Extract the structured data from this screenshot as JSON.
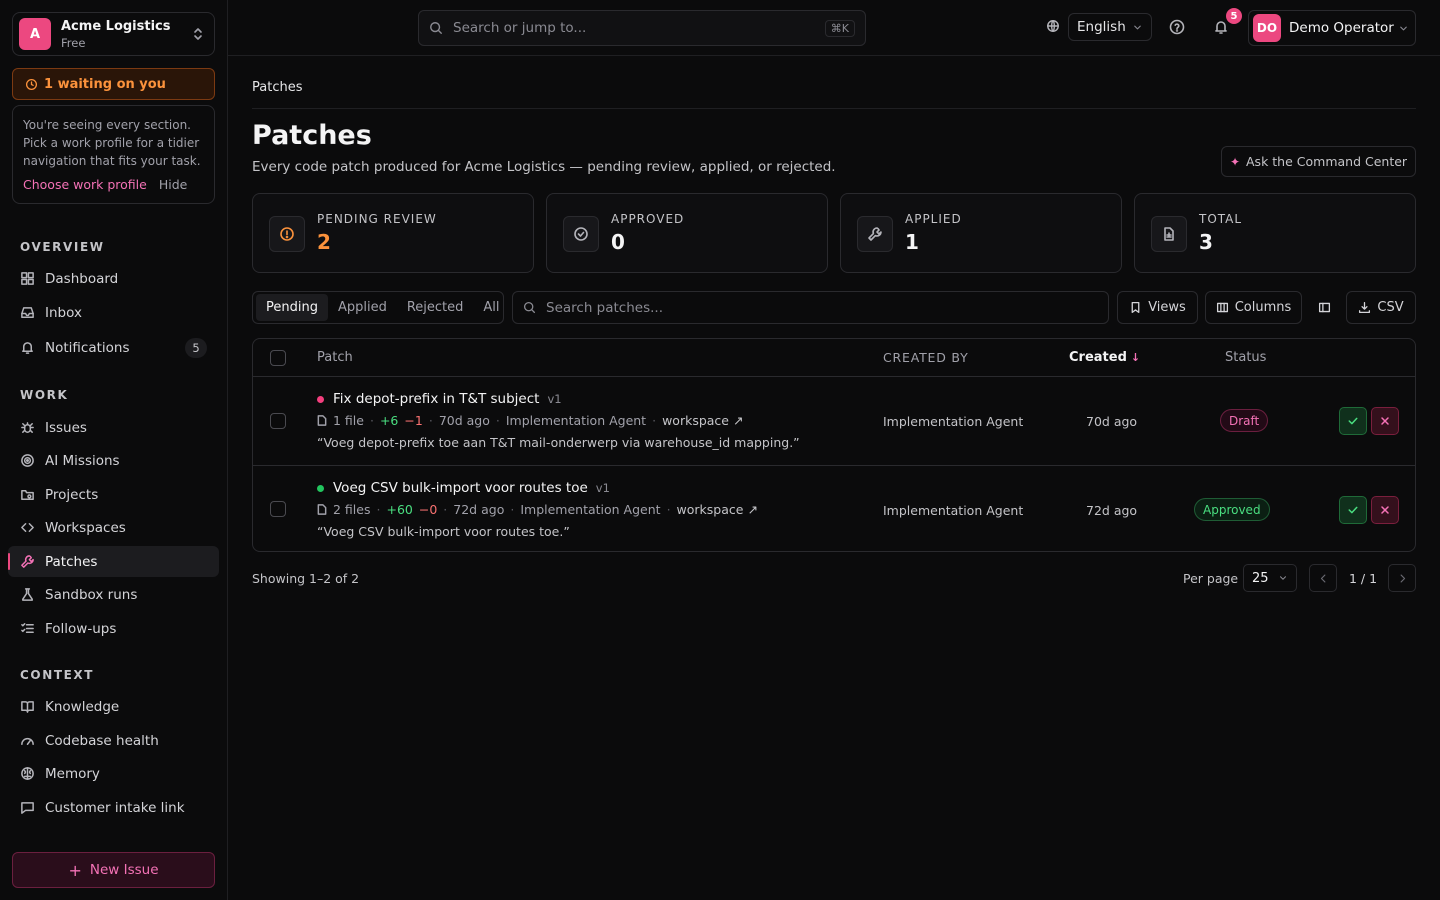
{
  "org": {
    "initial": "A",
    "name": "Acme Logistics",
    "plan": "Free"
  },
  "waiting": {
    "label": "1 waiting on you"
  },
  "profile_hint": {
    "text": "You're seeing every section. Pick a work profile for a tidier navigation that fits your task.",
    "choose_label": "Choose work profile",
    "hide_label": "Hide"
  },
  "sidebar": {
    "overview_label": "OVERVIEW",
    "work_label": "WORK",
    "context_label": "CONTEXT",
    "overview": [
      {
        "label": "Dashboard",
        "icon": "grid-icon"
      },
      {
        "label": "Inbox",
        "icon": "inbox-icon"
      },
      {
        "label": "Notifications",
        "icon": "bell-icon",
        "count": "5"
      }
    ],
    "work": [
      {
        "label": "Issues",
        "icon": "bug-icon"
      },
      {
        "label": "AI Missions",
        "icon": "target-icon"
      },
      {
        "label": "Projects",
        "icon": "folder-icon"
      },
      {
        "label": "Workspaces",
        "icon": "code-icon"
      },
      {
        "label": "Patches",
        "icon": "wrench-icon",
        "active": true
      },
      {
        "label": "Sandbox runs",
        "icon": "flask-icon"
      },
      {
        "label": "Follow-ups",
        "icon": "list-check-icon"
      }
    ],
    "context": [
      {
        "label": "Knowledge",
        "icon": "book-icon"
      },
      {
        "label": "Codebase health",
        "icon": "gauge-icon"
      },
      {
        "label": "Memory",
        "icon": "brain-icon"
      },
      {
        "label": "Customer intake link",
        "icon": "message-icon"
      }
    ],
    "new_issue_label": "New Issue",
    "accent": "#ec4880"
  },
  "topbar": {
    "search_placeholder": "Search or jump to...",
    "search_shortcut": "⌘K",
    "language": "English",
    "notif_count": "5",
    "user_initials": "DO",
    "user_name": "Demo Operator"
  },
  "page": {
    "breadcrumb": "Patches",
    "title": "Patches",
    "subtitle": "Every code patch produced for Acme Logistics — pending review, applied, or rejected.",
    "ask_label": "Ask the Command Center"
  },
  "stats": [
    {
      "label": "PENDING REVIEW",
      "value": "2",
      "icon": "alert-circle-icon"
    },
    {
      "label": "APPROVED",
      "value": "0",
      "icon": "check-circle-icon"
    },
    {
      "label": "APPLIED",
      "value": "1",
      "icon": "wrench-icon"
    },
    {
      "label": "TOTAL",
      "value": "3",
      "icon": "file-icon"
    }
  ],
  "filters": {
    "tabs": [
      "Pending",
      "Applied",
      "Rejected",
      "All"
    ],
    "active_tab": "Pending",
    "search_placeholder": "Search patches...",
    "views_label": "Views",
    "columns_label": "Columns",
    "csv_label": "CSV"
  },
  "table": {
    "headers": {
      "patch": "Patch",
      "created_by": "CREATED BY",
      "created": "Created",
      "status": "Status"
    },
    "rows": [
      {
        "title": "Fix depot-prefix in T&T subject",
        "version": "v1",
        "dot_color": "#f43f7e",
        "files": "1 file",
        "added": "+6",
        "removed": "−1",
        "age": "70d ago",
        "agent": "Implementation Agent",
        "workspace": "workspace",
        "quote": "“Voeg depot-prefix toe aan T&T mail-onderwerp via warehouse_id mapping.”",
        "created_by": "Implementation Agent",
        "created": "70d ago",
        "status": "Draft"
      },
      {
        "title": "Voeg CSV bulk-import voor routes toe",
        "version": "v1",
        "dot_color": "#22c55e",
        "files": "2 files",
        "added": "+60",
        "removed": "−0",
        "age": "72d ago",
        "agent": "Implementation Agent",
        "workspace": "workspace",
        "quote": "“Voeg CSV bulk-import voor routes toe.”",
        "created_by": "Implementation Agent",
        "created": "72d ago",
        "status": "Approved"
      }
    ]
  },
  "pagination": {
    "showing": "Showing 1–2 of 2",
    "per_page_label": "Per page",
    "per_page": "25",
    "page": "1 / 1"
  }
}
